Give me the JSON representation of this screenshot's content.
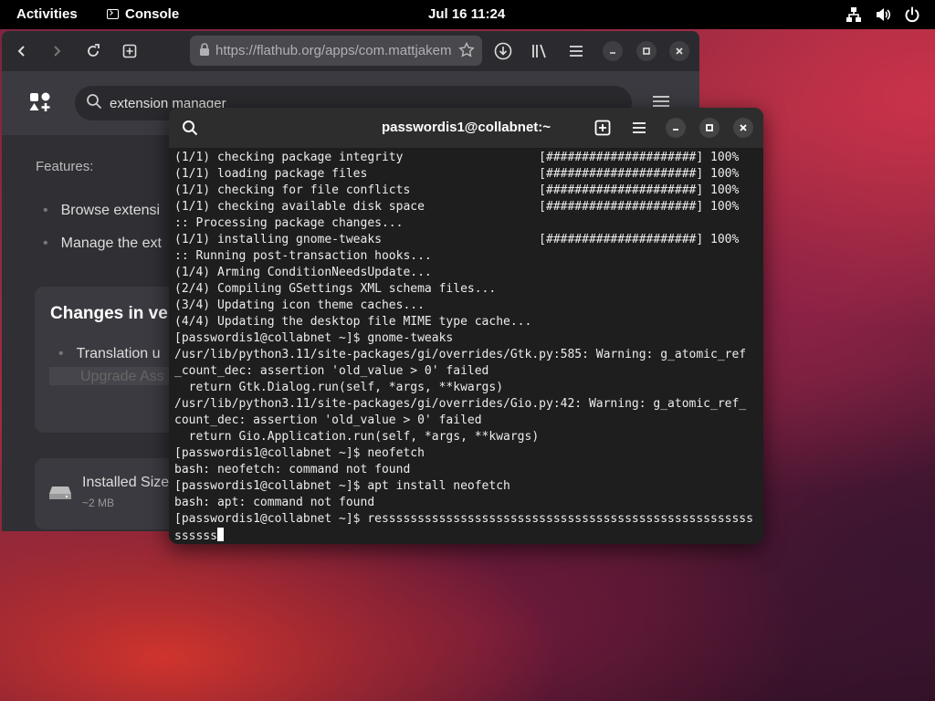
{
  "topbar": {
    "activities": "Activities",
    "app_name": "Console",
    "clock": "Jul 16  11:24"
  },
  "browser": {
    "url": "https://flathub.org/apps/com.mattjakem",
    "search_query": "extension manager",
    "features_label": "Features:",
    "feature_1": "Browse extensi",
    "feature_2": "Manage the ext",
    "changes_title": "Changes in ve",
    "changes_item": "Translation u",
    "changes_faded": "Upgrade Ass",
    "installed_label": "Installed Size",
    "installed_value": "~2 MB"
  },
  "terminal": {
    "title": "passwordis1@collabnet:~",
    "lines": [
      "(1/1) checking package integrity                   [#####################] 100%",
      "(1/1) loading package files                        [#####################] 100%",
      "(1/1) checking for file conflicts                  [#####################] 100%",
      "(1/1) checking available disk space                [#####################] 100%",
      ":: Processing package changes...",
      "(1/1) installing gnome-tweaks                      [#####################] 100%",
      ":: Running post-transaction hooks...",
      "(1/4) Arming ConditionNeedsUpdate...",
      "(2/4) Compiling GSettings XML schema files...",
      "(3/4) Updating icon theme caches...",
      "(4/4) Updating the desktop file MIME type cache...",
      "[passwordis1@collabnet ~]$ gnome-tweaks",
      "/usr/lib/python3.11/site-packages/gi/overrides/Gtk.py:585: Warning: g_atomic_ref",
      "_count_dec: assertion 'old_value > 0' failed",
      "  return Gtk.Dialog.run(self, *args, **kwargs)",
      "/usr/lib/python3.11/site-packages/gi/overrides/Gio.py:42: Warning: g_atomic_ref_",
      "count_dec: assertion 'old_value > 0' failed",
      "  return Gio.Application.run(self, *args, **kwargs)",
      "[passwordis1@collabnet ~]$ neofetch",
      "bash: neofetch: command not found",
      "[passwordis1@collabnet ~]$ apt install neofetch",
      "bash: apt: command not found",
      "[passwordis1@collabnet ~]$ ressssssssssssssssssssssssssssssssssssssssssssssssssss"
    ],
    "input_line": "ssssss"
  }
}
